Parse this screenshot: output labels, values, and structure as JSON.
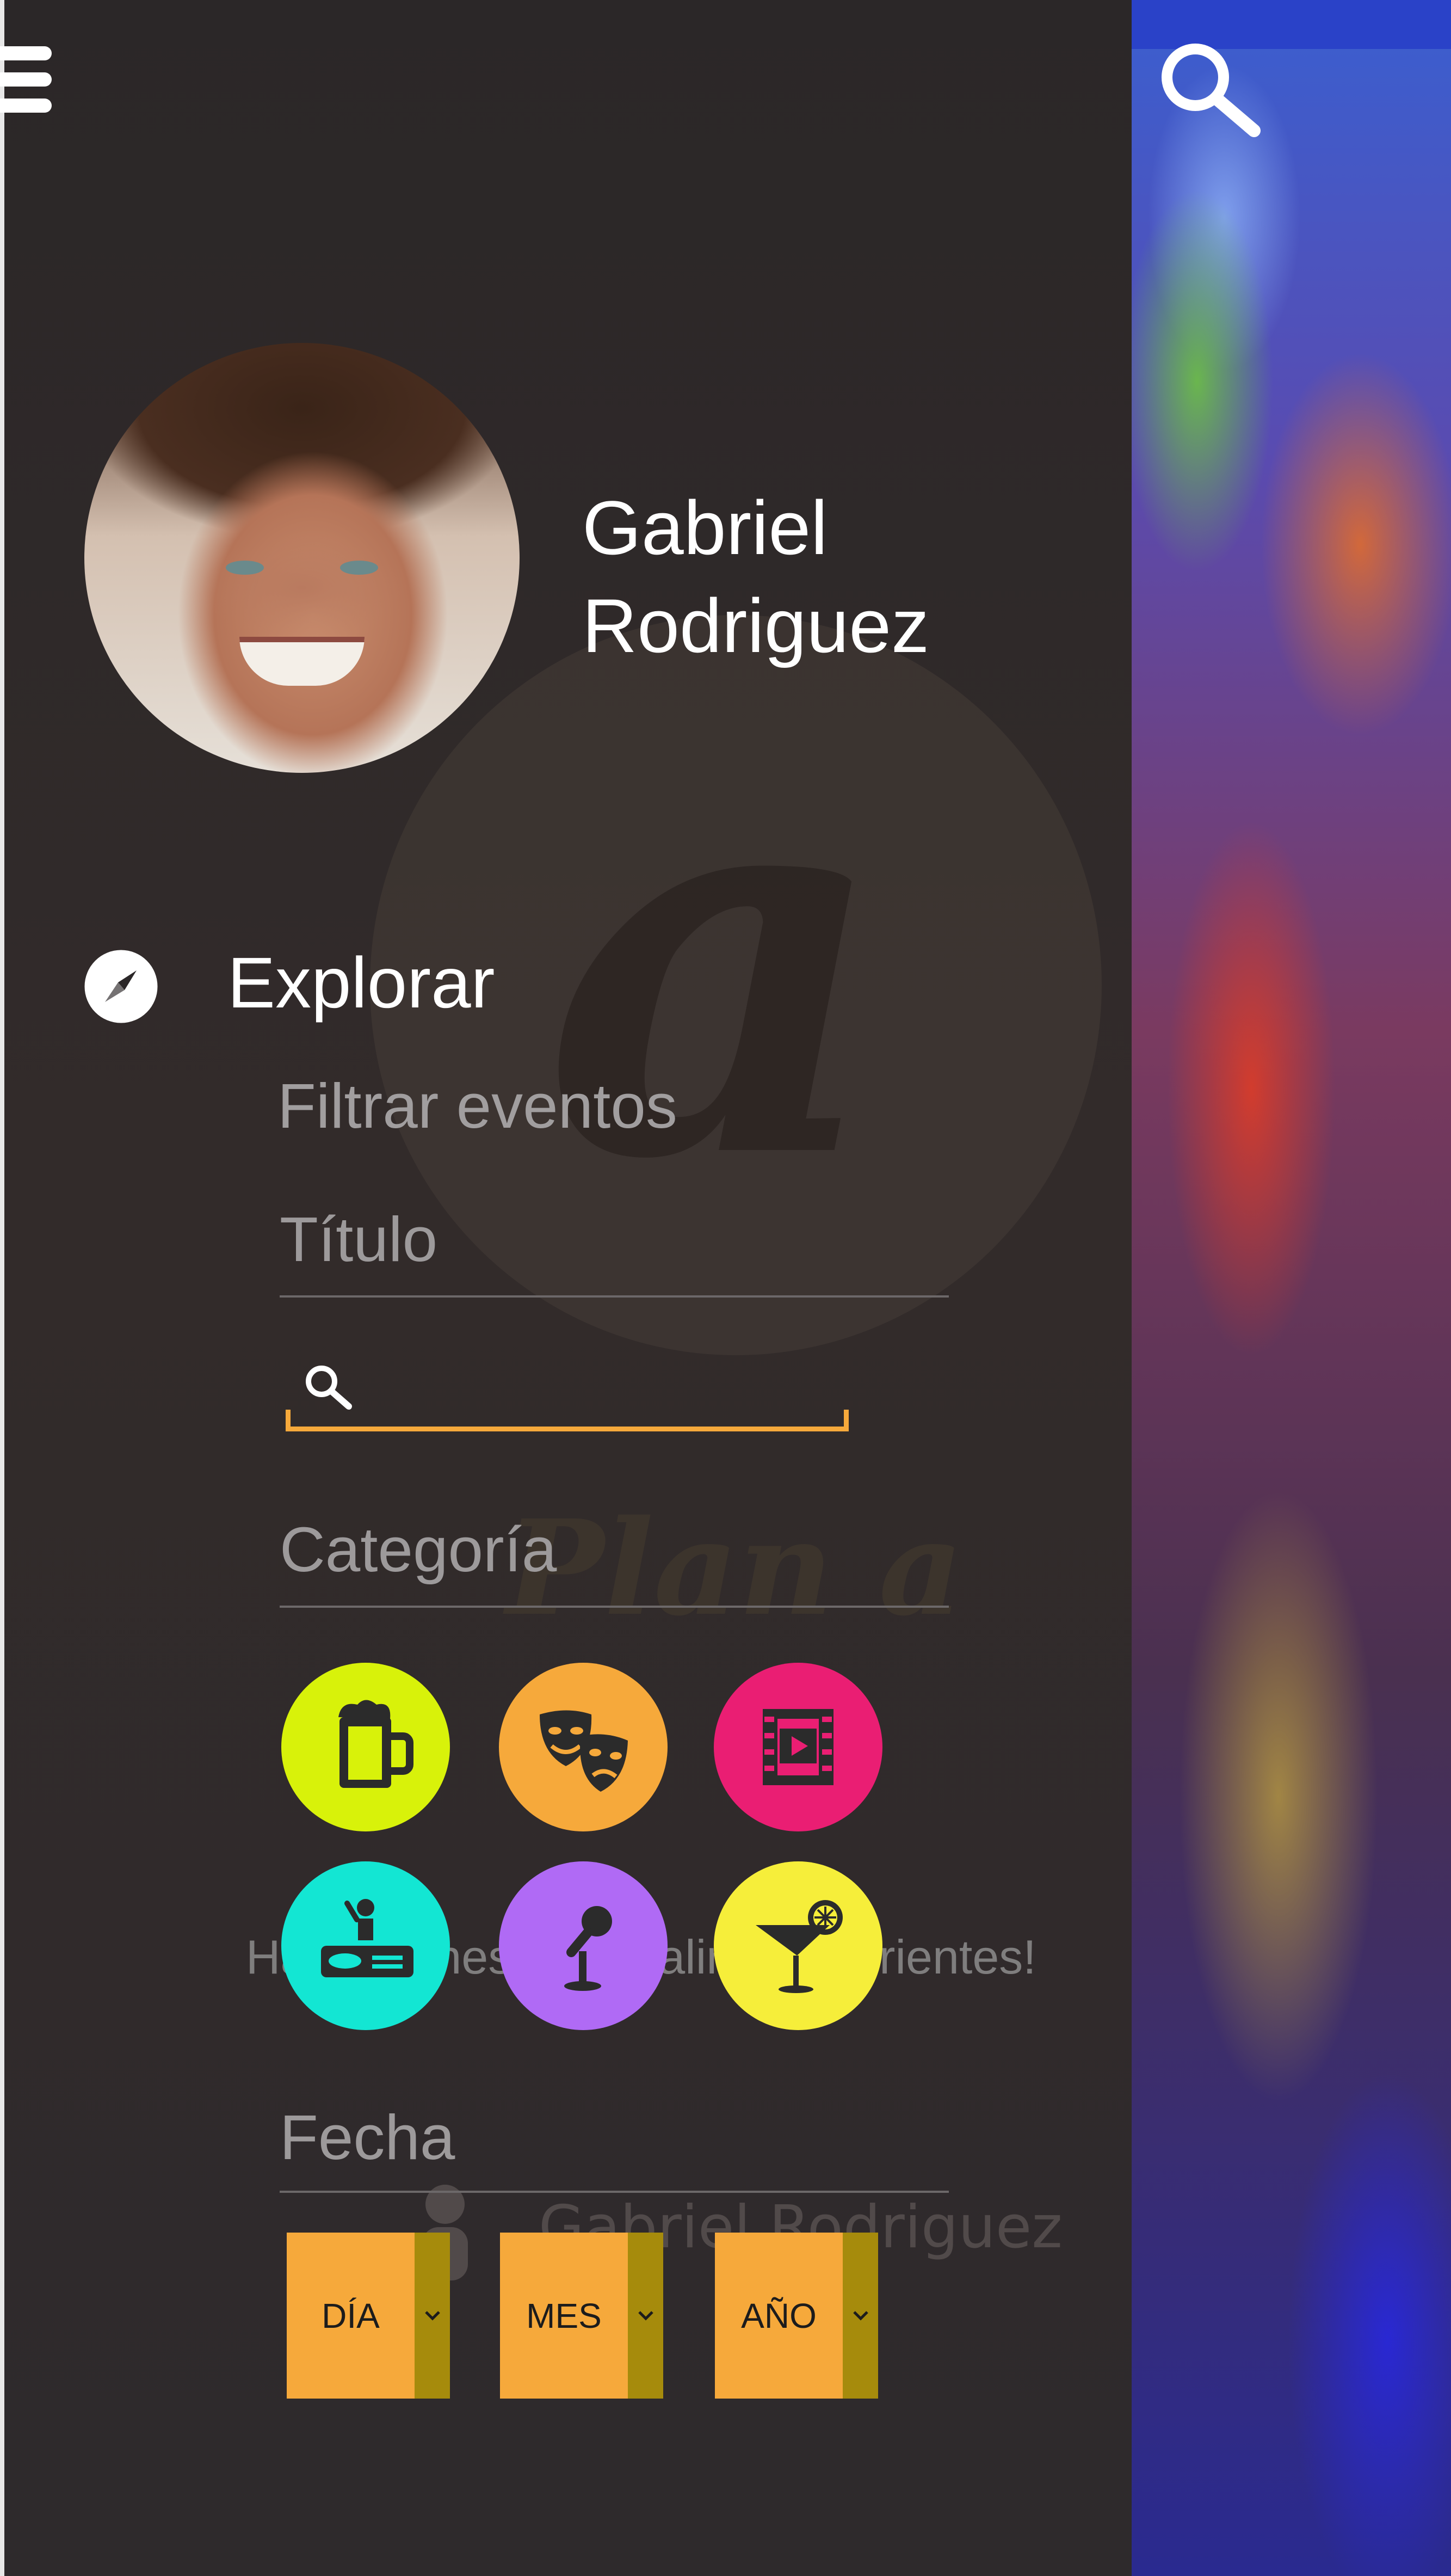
{
  "header": {
    "menu_icon": "hamburger-icon",
    "search_icon": "search-icon"
  },
  "profile": {
    "name": "Gabriel Rodriguez"
  },
  "nav": {
    "explore_label": "Explorar",
    "explore_icon": "compass-icon"
  },
  "filters": {
    "title": "Filtrar eventos",
    "title_section": "Título",
    "search_placeholder": "",
    "category_section": "Categoría",
    "categories": [
      {
        "name": "beer-icon",
        "color": "#d8f20a"
      },
      {
        "name": "theater-masks-icon",
        "color": "#f6a93b"
      },
      {
        "name": "film-icon",
        "color": "#ea1e73"
      },
      {
        "name": "dj-icon",
        "color": "#13e6d3"
      },
      {
        "name": "microphone-icon",
        "color": "#b06af5"
      },
      {
        "name": "cocktail-icon",
        "color": "#f6ee3a"
      }
    ],
    "date_section": "Fecha",
    "date_day": "DÍA",
    "date_month": "MES",
    "date_year": "AÑO"
  },
  "background": {
    "logo_text": "Plan a",
    "tagline": "Hacé planes para salir en Corrientes!",
    "user_name": "Gabriel Rodriguez"
  },
  "colors": {
    "accent": "#f6a93b",
    "drawer": "#2b2728",
    "label_gray": "#9d9a9b"
  }
}
